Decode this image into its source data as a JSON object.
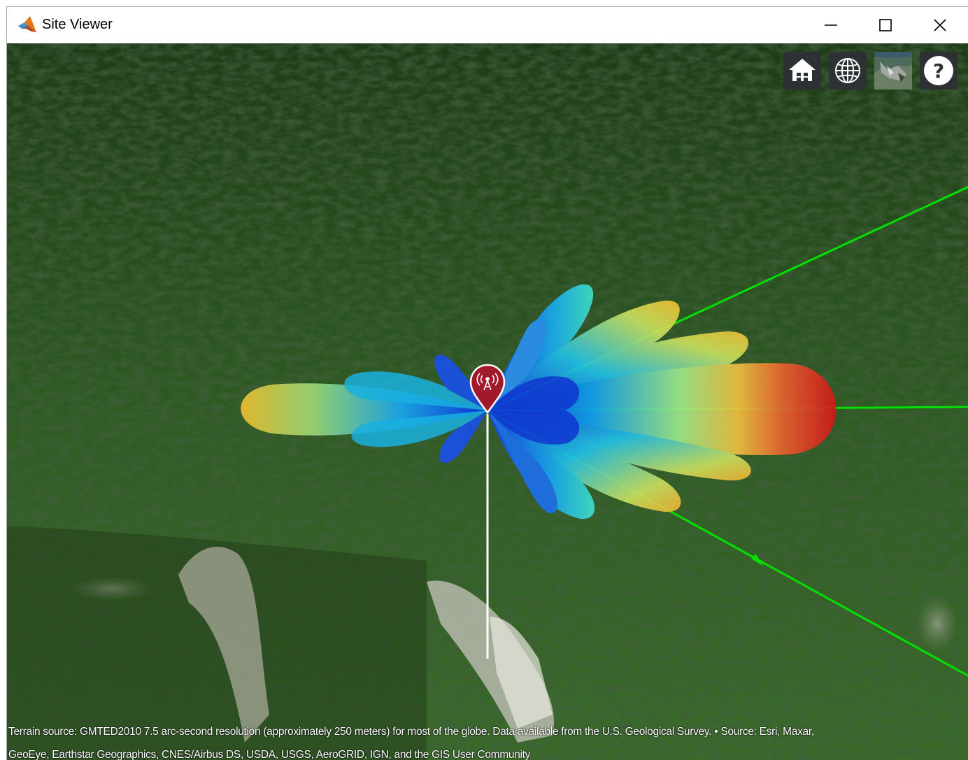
{
  "window": {
    "title": "Site Viewer",
    "controls": {
      "minimize_icon": "minimize-icon",
      "maximize_icon": "maximize-icon",
      "close_icon": "close-icon"
    }
  },
  "toolbar": {
    "buttons": [
      {
        "icon": "home-icon"
      },
      {
        "icon": "globe-icon"
      },
      {
        "icon": "basemap-thumbnail-icon"
      },
      {
        "icon": "help-icon",
        "label": "?"
      }
    ]
  },
  "scene": {
    "transmitter_marker_icon": "antenna-tower-icon",
    "colors": {
      "marker": "#a01a2c",
      "ray": "#00e000",
      "mast": "#ffffff",
      "terrain": "#2c5220"
    }
  },
  "attribution": {
    "line1": "Terrain source: GMTED2010 7.5 arc-second resolution (approximately 250 meters) for most of the globe. Data available from the U.S. Geological Survey. • Source: Esri, Maxar,",
    "line2": "GeoEye, Earthstar Geographics, CNES/Airbus DS, USDA, USGS, AeroGRID, IGN, and the GIS User Community"
  }
}
